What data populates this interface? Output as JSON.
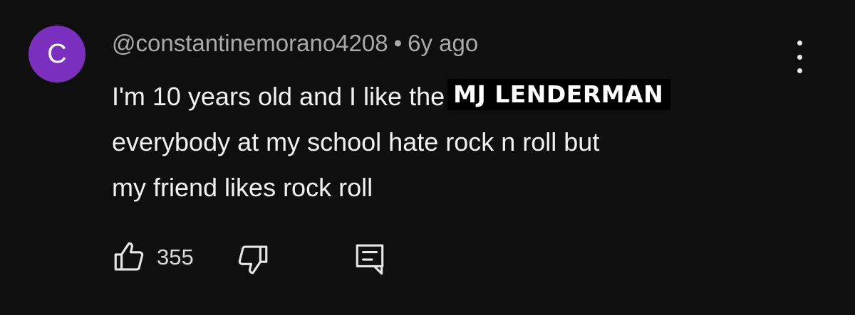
{
  "comment": {
    "avatar_letter": "C",
    "avatar_color": "#7b2fbe",
    "username": "@constantinemorano4208",
    "separator": "•",
    "age": "6y ago",
    "text_line1": "I'm 10 years old and I like the",
    "overlay_text": "MJ LENDERMAN",
    "text_line2": "everybody at my school hate rock n roll but",
    "text_line3": "my friend likes rock roll",
    "like_count": "355"
  },
  "icons": {
    "like": "thumbs-up-icon",
    "dislike": "thumbs-down-icon",
    "reply": "reply-comment-icon",
    "menu": "more-vertical-icon"
  }
}
